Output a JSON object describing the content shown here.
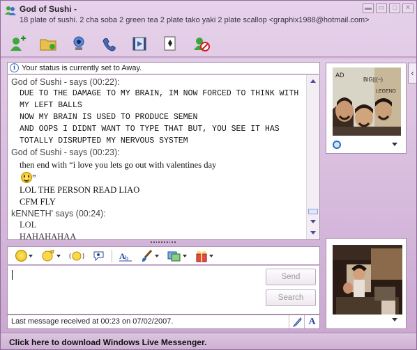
{
  "window": {
    "contact_name": "God of Sushi -",
    "personal_message": "18 plate of sushi. 2 cha soba 2 green tea 2 plate tako yaki 2 plate scallop <graphix1988@hotmail.com>",
    "controls": [
      "minimize",
      "restore",
      "maximize",
      "close"
    ]
  },
  "toolbar": {
    "buttons": [
      {
        "name": "invite-icon"
      },
      {
        "name": "send-files-icon"
      },
      {
        "name": "video-call-icon"
      },
      {
        "name": "voice-call-icon"
      },
      {
        "name": "activities-icon"
      },
      {
        "name": "games-icon"
      },
      {
        "name": "block-icon"
      }
    ]
  },
  "status_bar": {
    "text": "Your status is currently set to Away."
  },
  "conversation": [
    {
      "sender": "God of Sushi - says (00:22):",
      "lines": [
        "DUE TO THE DAMAGE TO MY BRAIN, IM NOW FORCED TO THINK WITH",
        "MY LEFT BALLS",
        "NOW MY BRAIN IS USED TO PRODUCE SEMEN",
        "AND OOPS I DIDNT WANT TO TYPE THAT BUT, YOU SEE IT HAS",
        "TOTALLY DISRUPTED MY NERVOUS SYSTEM"
      ]
    },
    {
      "sender": "God of Sushi - says (00:23):",
      "lines": [
        "then end with “i love you lets go out with valentines day",
        "”",
        "LOL THE PERSON READ LIAO",
        "CFM FLY"
      ]
    },
    {
      "sender": "kENNETH' says (00:24):",
      "lines": [
        "LOL",
        "HAHAHAHAA"
      ]
    }
  ],
  "input": {
    "value": "",
    "send_label": "Send",
    "search_label": "Search"
  },
  "last_message": "Last message received at 00:23 on 07/02/2007.",
  "footer": {
    "link_text": "Click here to download Windows Live Messenger."
  },
  "photo_text": {
    "line1": "AD",
    "line2": "BIG||(~)",
    "line3": "LEGEND"
  },
  "colors": {
    "frame": "#d6b9dc",
    "border": "#a88fad",
    "accent_blue": "#2a4aa0"
  }
}
